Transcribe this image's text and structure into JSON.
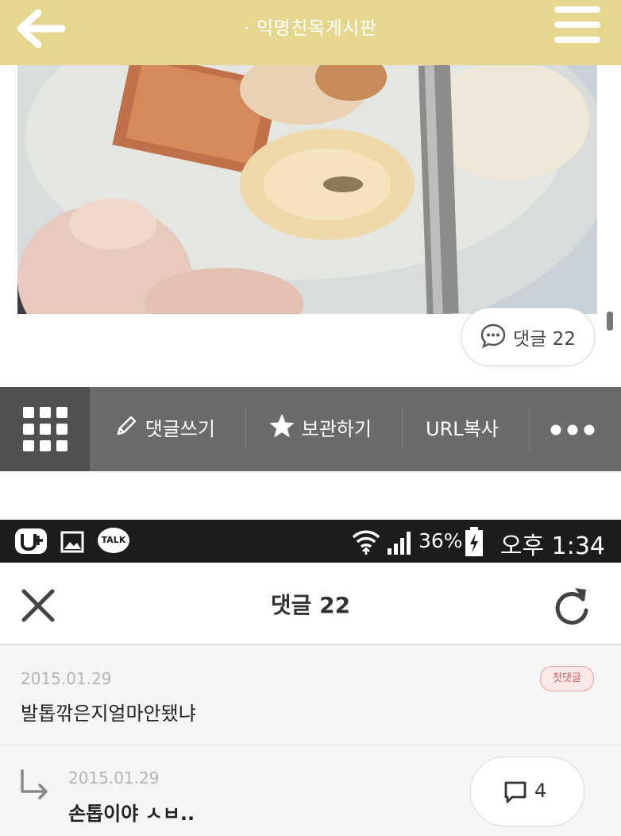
{
  "topbar": {
    "title": "· 익명친목게시판"
  },
  "post": {
    "comment_count_label": "댓글 22"
  },
  "toolbar": {
    "write_comment": "댓글쓰기",
    "save": "보관하기",
    "copy_url": "URL복사"
  },
  "status_bar": {
    "battery_percent": "36%",
    "time": "오후 1:34",
    "talk_label": "TALK"
  },
  "comments_sheet": {
    "title": "댓글 22",
    "comments": [
      {
        "date": "2015.01.29",
        "text": "발톱깎은지얼마안됐냐",
        "badge": "첫댓글"
      },
      {
        "date": "2015.01.29",
        "text": "손톱이야 ㅅㅂ..",
        "reply_count": "4"
      }
    ]
  },
  "colors": {
    "header": "#e6d78f",
    "toolbar": "#6b6b6b",
    "toolbar_grid": "#505050",
    "status_bar": "#1c1c1c",
    "badge": "#d05a5a"
  },
  "icons": [
    "back-arrow-icon",
    "hamburger-menu-icon",
    "speech-bubble-icon",
    "grid-menu-icon",
    "pencil-icon",
    "star-icon",
    "more-dots-icon",
    "close-icon",
    "refresh-icon",
    "reply-arrow-icon",
    "wifi-icon",
    "signal-icon",
    "battery-icon"
  ]
}
